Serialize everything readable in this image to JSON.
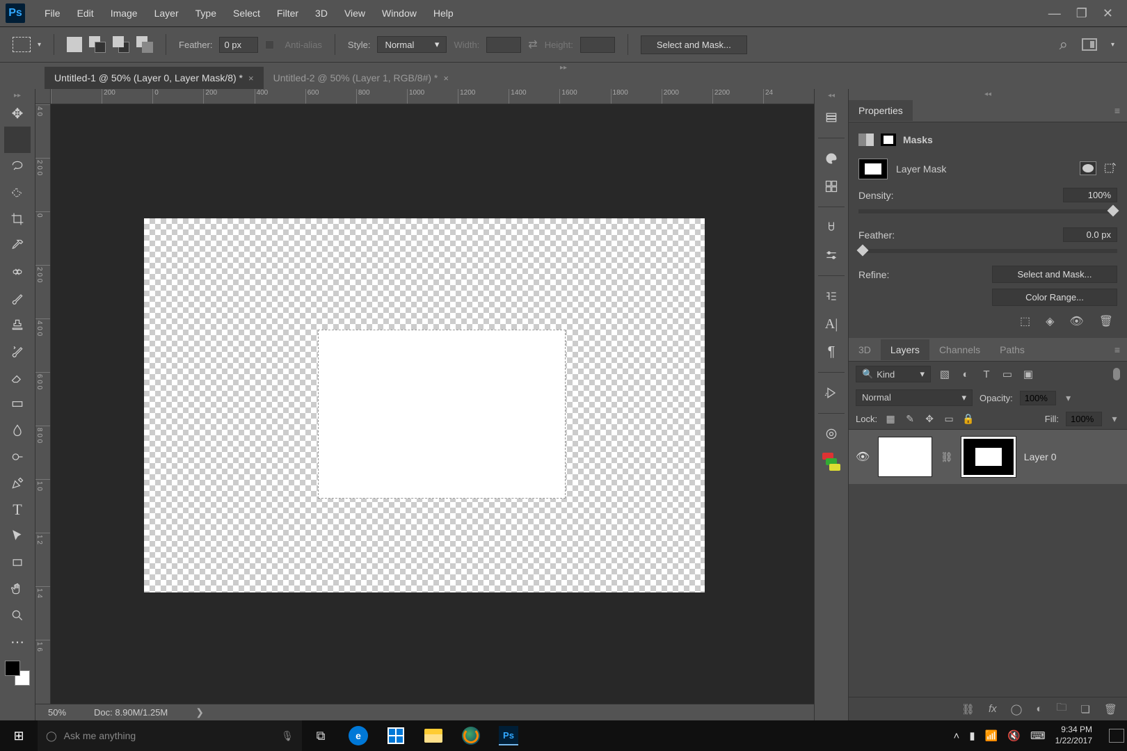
{
  "menubar": {
    "items": [
      "File",
      "Edit",
      "Image",
      "Layer",
      "Type",
      "Select",
      "Filter",
      "3D",
      "View",
      "Window",
      "Help"
    ]
  },
  "optbar": {
    "feather_label": "Feather:",
    "feather_value": "0 px",
    "antialias_label": "Anti-alias",
    "style_label": "Style:",
    "style_value": "Normal",
    "width_label": "Width:",
    "height_label": "Height:",
    "select_mask_btn": "Select and Mask..."
  },
  "tabs": [
    {
      "title": "Untitled-1 @ 50% (Layer 0, Layer Mask/8) *",
      "active": true
    },
    {
      "title": "Untitled-2 @ 50% (Layer 1, RGB/8#) *",
      "active": false
    }
  ],
  "ruler_h": [
    "",
    "200",
    "0",
    "200",
    "400",
    "600",
    "800",
    "1000",
    "1200",
    "1400",
    "1600",
    "1800",
    "2000",
    "2200",
    "24"
  ],
  "ruler_v": [
    "4 0",
    "2 0 0",
    "0",
    "2 0 0",
    "4 0 0",
    "6 0 0",
    "8 0 0",
    "1 0",
    "1 2",
    "1 4",
    "1 6"
  ],
  "status": {
    "zoom": "50%",
    "doc": "Doc: 8.90M/1.25M"
  },
  "properties": {
    "panel_title": "Properties",
    "section": "Masks",
    "mask_name": "Layer Mask",
    "density_label": "Density:",
    "density_value": "100%",
    "feather_label": "Feather:",
    "feather_value": "0.0 px",
    "refine_label": "Refine:",
    "refine_btn1": "Select and Mask...",
    "refine_btn2": "Color Range..."
  },
  "layers_panel": {
    "tabs": [
      "3D",
      "Layers",
      "Channels",
      "Paths"
    ],
    "kind_label": "Kind",
    "blend": "Normal",
    "opacity_label": "Opacity:",
    "opacity_value": "100%",
    "lock_label": "Lock:",
    "fill_label": "Fill:",
    "fill_value": "100%",
    "layers": [
      {
        "name": "Layer 0"
      }
    ]
  },
  "taskbar": {
    "search_placeholder": "Ask me anything",
    "time": "9:34 PM",
    "date": "1/22/2017"
  }
}
